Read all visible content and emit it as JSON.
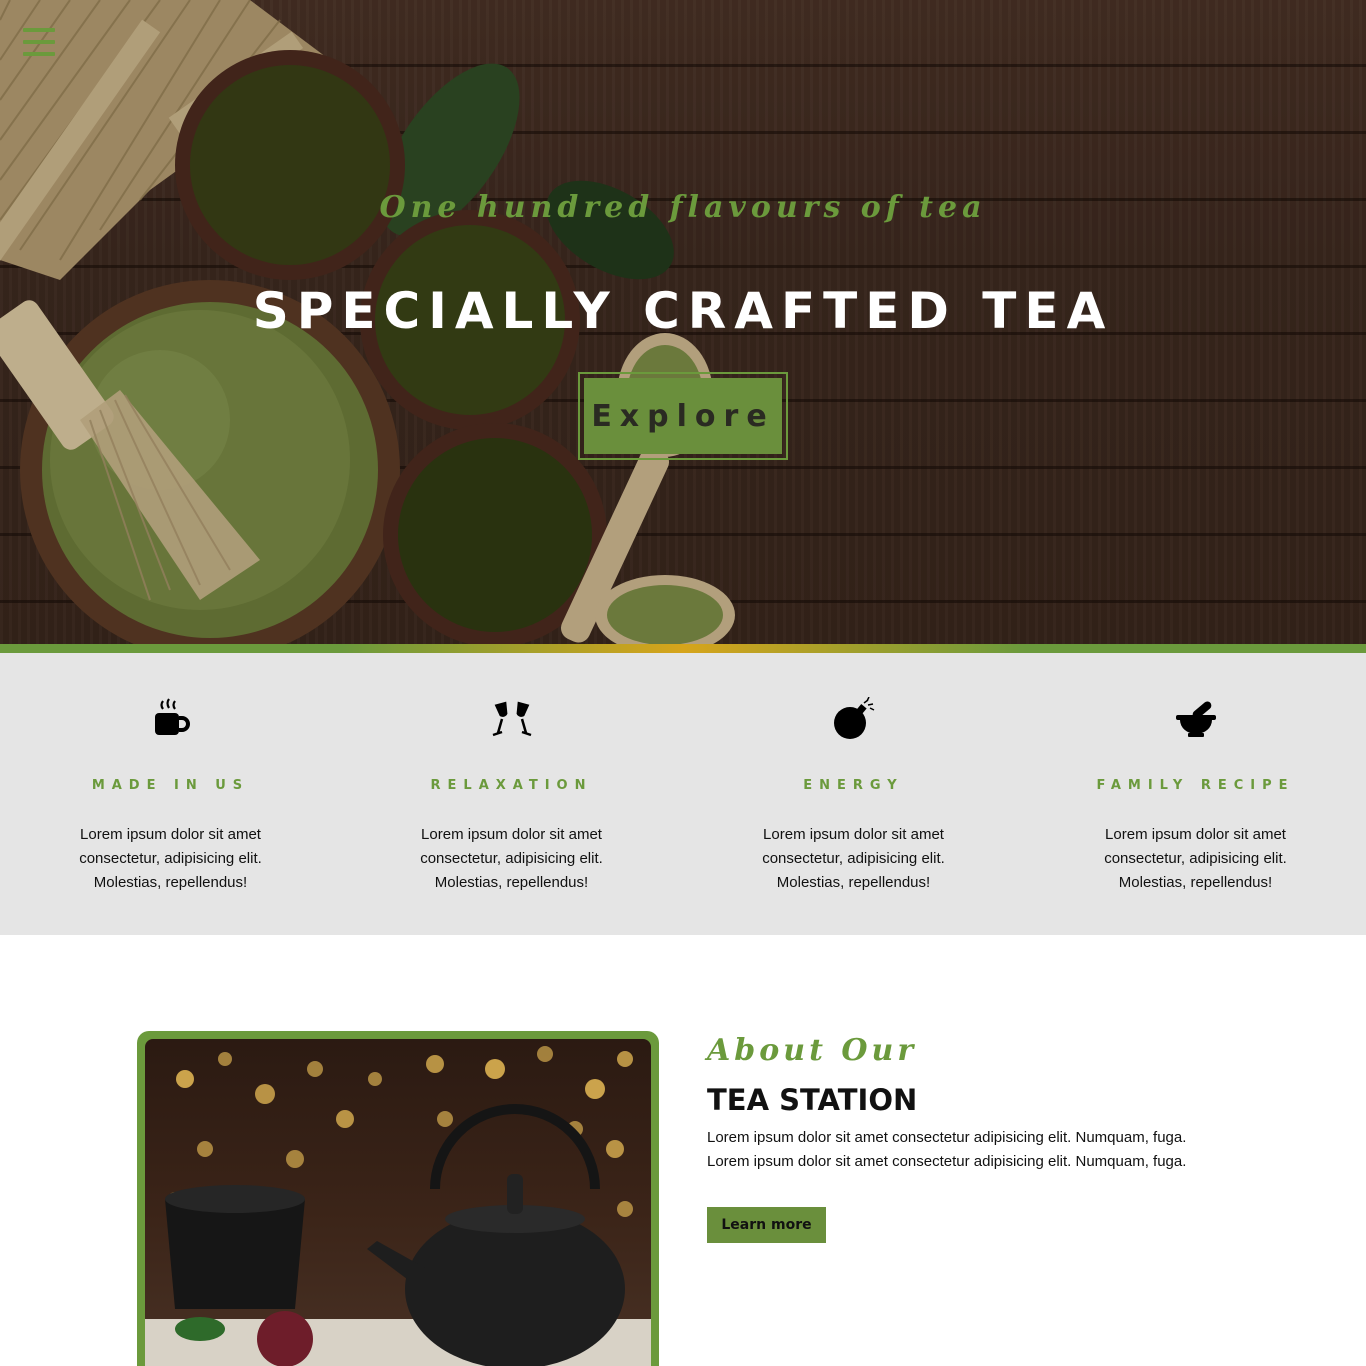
{
  "colors": {
    "accent_green": "#6b9a3c",
    "button_green": "#6a8f3c",
    "accent_gold": "#d6a41b",
    "features_bg": "#e5e5e5",
    "hero_wood": "#3f2a20"
  },
  "nav": {
    "menu_icon": "hamburger-menu-icon"
  },
  "hero": {
    "tagline": "One hundred flavours of tea",
    "title": "SPECIALLY CRAFTED TEA",
    "cta_label": "Explore"
  },
  "features": [
    {
      "icon": "hot-coffee-mug-icon",
      "title": "MADE IN US",
      "text": "Lorem ipsum dolor sit amet consectetur, adipisicing elit. Molestias, repellendus!"
    },
    {
      "icon": "glasses-cheers-icon",
      "title": "RELAXATION",
      "text": "Lorem ipsum dolor sit amet consectetur, adipisicing elit. Molestias, repellendus!"
    },
    {
      "icon": "bomb-icon",
      "title": "ENERGY",
      "text": "Lorem ipsum dolor sit amet consectetur, adipisicing elit. Molestias, repellendus!"
    },
    {
      "icon": "mortar-pestle-icon",
      "title": "FAMILY RECIPE",
      "text": "Lorem ipsum dolor sit amet consectetur, adipisicing elit. Molestias, repellendus!"
    }
  ],
  "about": {
    "script_heading": "About Our",
    "title": "TEA STATION",
    "text": "Lorem ipsum dolor sit amet consectetur adipisicing elit. Numquam, fuga. Lorem ipsum dolor sit amet consectetur adipisicing elit. Numquam, fuga.",
    "button_label": "Learn more"
  }
}
